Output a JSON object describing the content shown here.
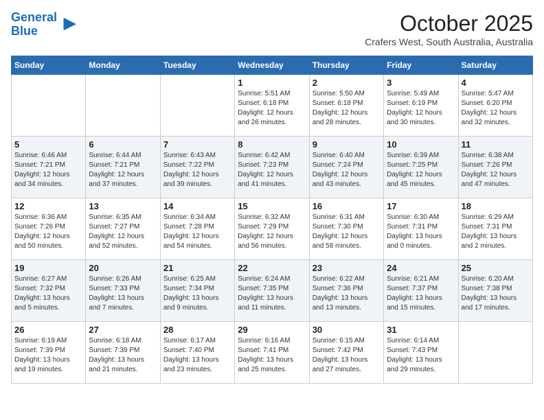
{
  "header": {
    "logo_line1": "General",
    "logo_line2": "Blue",
    "month": "October 2025",
    "location": "Crafers West, South Australia, Australia"
  },
  "weekdays": [
    "Sunday",
    "Monday",
    "Tuesday",
    "Wednesday",
    "Thursday",
    "Friday",
    "Saturday"
  ],
  "weeks": [
    [
      {
        "day": "",
        "info": ""
      },
      {
        "day": "",
        "info": ""
      },
      {
        "day": "",
        "info": ""
      },
      {
        "day": "1",
        "info": "Sunrise: 5:51 AM\nSunset: 6:18 PM\nDaylight: 12 hours\nand 26 minutes."
      },
      {
        "day": "2",
        "info": "Sunrise: 5:50 AM\nSunset: 6:18 PM\nDaylight: 12 hours\nand 28 minutes."
      },
      {
        "day": "3",
        "info": "Sunrise: 5:49 AM\nSunset: 6:19 PM\nDaylight: 12 hours\nand 30 minutes."
      },
      {
        "day": "4",
        "info": "Sunrise: 5:47 AM\nSunset: 6:20 PM\nDaylight: 12 hours\nand 32 minutes."
      }
    ],
    [
      {
        "day": "5",
        "info": "Sunrise: 6:46 AM\nSunset: 7:21 PM\nDaylight: 12 hours\nand 34 minutes."
      },
      {
        "day": "6",
        "info": "Sunrise: 6:44 AM\nSunset: 7:21 PM\nDaylight: 12 hours\nand 37 minutes."
      },
      {
        "day": "7",
        "info": "Sunrise: 6:43 AM\nSunset: 7:22 PM\nDaylight: 12 hours\nand 39 minutes."
      },
      {
        "day": "8",
        "info": "Sunrise: 6:42 AM\nSunset: 7:23 PM\nDaylight: 12 hours\nand 41 minutes."
      },
      {
        "day": "9",
        "info": "Sunrise: 6:40 AM\nSunset: 7:24 PM\nDaylight: 12 hours\nand 43 minutes."
      },
      {
        "day": "10",
        "info": "Sunrise: 6:39 AM\nSunset: 7:25 PM\nDaylight: 12 hours\nand 45 minutes."
      },
      {
        "day": "11",
        "info": "Sunrise: 6:38 AM\nSunset: 7:26 PM\nDaylight: 12 hours\nand 47 minutes."
      }
    ],
    [
      {
        "day": "12",
        "info": "Sunrise: 6:36 AM\nSunset: 7:26 PM\nDaylight: 12 hours\nand 50 minutes."
      },
      {
        "day": "13",
        "info": "Sunrise: 6:35 AM\nSunset: 7:27 PM\nDaylight: 12 hours\nand 52 minutes."
      },
      {
        "day": "14",
        "info": "Sunrise: 6:34 AM\nSunset: 7:28 PM\nDaylight: 12 hours\nand 54 minutes."
      },
      {
        "day": "15",
        "info": "Sunrise: 6:32 AM\nSunset: 7:29 PM\nDaylight: 12 hours\nand 56 minutes."
      },
      {
        "day": "16",
        "info": "Sunrise: 6:31 AM\nSunset: 7:30 PM\nDaylight: 12 hours\nand 58 minutes."
      },
      {
        "day": "17",
        "info": "Sunrise: 6:30 AM\nSunset: 7:31 PM\nDaylight: 13 hours\nand 0 minutes."
      },
      {
        "day": "18",
        "info": "Sunrise: 6:29 AM\nSunset: 7:31 PM\nDaylight: 13 hours\nand 2 minutes."
      }
    ],
    [
      {
        "day": "19",
        "info": "Sunrise: 6:27 AM\nSunset: 7:32 PM\nDaylight: 13 hours\nand 5 minutes."
      },
      {
        "day": "20",
        "info": "Sunrise: 6:26 AM\nSunset: 7:33 PM\nDaylight: 13 hours\nand 7 minutes."
      },
      {
        "day": "21",
        "info": "Sunrise: 6:25 AM\nSunset: 7:34 PM\nDaylight: 13 hours\nand 9 minutes."
      },
      {
        "day": "22",
        "info": "Sunrise: 6:24 AM\nSunset: 7:35 PM\nDaylight: 13 hours\nand 11 minutes."
      },
      {
        "day": "23",
        "info": "Sunrise: 6:22 AM\nSunset: 7:36 PM\nDaylight: 13 hours\nand 13 minutes."
      },
      {
        "day": "24",
        "info": "Sunrise: 6:21 AM\nSunset: 7:37 PM\nDaylight: 13 hours\nand 15 minutes."
      },
      {
        "day": "25",
        "info": "Sunrise: 6:20 AM\nSunset: 7:38 PM\nDaylight: 13 hours\nand 17 minutes."
      }
    ],
    [
      {
        "day": "26",
        "info": "Sunrise: 6:19 AM\nSunset: 7:39 PM\nDaylight: 13 hours\nand 19 minutes."
      },
      {
        "day": "27",
        "info": "Sunrise: 6:18 AM\nSunset: 7:39 PM\nDaylight: 13 hours\nand 21 minutes."
      },
      {
        "day": "28",
        "info": "Sunrise: 6:17 AM\nSunset: 7:40 PM\nDaylight: 13 hours\nand 23 minutes."
      },
      {
        "day": "29",
        "info": "Sunrise: 6:16 AM\nSunset: 7:41 PM\nDaylight: 13 hours\nand 25 minutes."
      },
      {
        "day": "30",
        "info": "Sunrise: 6:15 AM\nSunset: 7:42 PM\nDaylight: 13 hours\nand 27 minutes."
      },
      {
        "day": "31",
        "info": "Sunrise: 6:14 AM\nSunset: 7:43 PM\nDaylight: 13 hours\nand 29 minutes."
      },
      {
        "day": "",
        "info": ""
      }
    ]
  ]
}
